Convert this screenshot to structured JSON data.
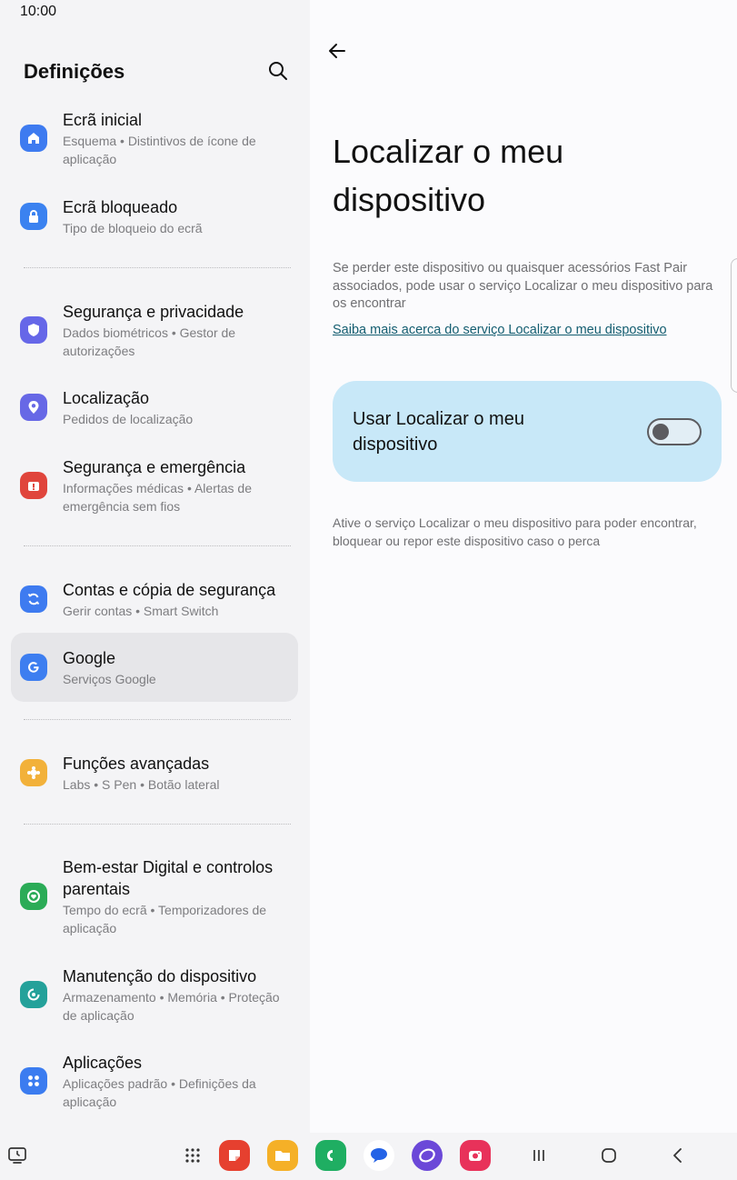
{
  "status": {
    "time": "10:00"
  },
  "settings": {
    "title": "Definições",
    "items": [
      {
        "title": "Ecrã inicial",
        "subtitle": "Esquema • Distintivos de ícone de aplicação",
        "icon": "home-icon",
        "color": "#3e7bf0"
      },
      {
        "title": "Ecrã bloqueado",
        "subtitle": "Tipo de bloqueio do ecrã",
        "icon": "lock-icon",
        "color": "#3b82f0"
      },
      {
        "title": "Segurança e privacidade",
        "subtitle": "Dados biométricos • Gestor de autorizações",
        "icon": "shield-icon",
        "color": "#6667e8"
      },
      {
        "title": "Localização",
        "subtitle": "Pedidos de localização",
        "icon": "location-pin-icon",
        "color": "#6768e6"
      },
      {
        "title": "Segurança e emergência",
        "subtitle": "Informações médicas • Alertas de emergência sem fios",
        "icon": "emergency-icon",
        "color": "#e0453c"
      },
      {
        "title": "Contas e cópia de segurança",
        "subtitle": "Gerir contas • Smart Switch",
        "icon": "sync-icon",
        "color": "#3e7bf0"
      },
      {
        "title": "Google",
        "subtitle": "Serviços Google",
        "icon": "google-icon",
        "color": "#3d7ef0"
      },
      {
        "title": "Funções avançadas",
        "subtitle": "Labs • S Pen • Botão lateral",
        "icon": "gear-puzzle-icon",
        "color": "#f2b13a"
      },
      {
        "title": "Bem-estar Digital e controlos parentais",
        "subtitle": "Tempo do ecrã • Temporizadores de aplicação",
        "icon": "wellbeing-icon",
        "color": "#2bab57"
      },
      {
        "title": "Manutenção do dispositivo",
        "subtitle": "Armazenamento • Memória • Proteção de aplicação",
        "icon": "device-care-icon",
        "color": "#24a19a"
      },
      {
        "title": "Aplicações",
        "subtitle": "Aplicações padrão • Definições da aplicação",
        "icon": "apps-icon",
        "color": "#3b7cf0"
      }
    ]
  },
  "detail": {
    "title": "Localizar o meu dispositivo",
    "description": "Se perder este dispositivo ou quaisquer acessórios Fast Pair associados, pode usar o serviço Localizar o meu dispositivo para os encontrar",
    "link": "Saiba mais acerca do serviço Localizar o meu dispositivo",
    "toggle_label": "Usar Localizar o meu dispositivo",
    "toggle_on": false,
    "note": "Ative o serviço Localizar o meu dispositivo para poder encontrar, bloquear ou repor este dispositivo caso o perca"
  },
  "dock": {
    "apps": [
      "samsung-notes-icon",
      "my-files-icon",
      "phone-icon",
      "messages-icon",
      "samsung-internet-icon",
      "camera-icon"
    ]
  }
}
